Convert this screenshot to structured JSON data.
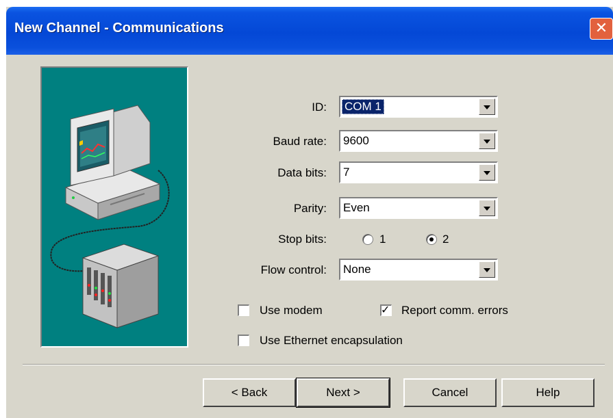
{
  "window": {
    "title": "New Channel - Communications",
    "close_glyph": "✕"
  },
  "form": {
    "id": {
      "label": "ID:",
      "value": "COM 1"
    },
    "baud_rate": {
      "label": "Baud rate:",
      "value": "9600"
    },
    "data_bits": {
      "label": "Data bits:",
      "value": "7"
    },
    "parity": {
      "label": "Parity:",
      "value": "Even"
    },
    "stop_bits": {
      "label": "Stop bits:",
      "options": [
        "1",
        "2"
      ],
      "selected": "2"
    },
    "flow_control": {
      "label": "Flow control:",
      "value": "None"
    }
  },
  "options": {
    "use_modem": {
      "label": "Use modem",
      "checked": false
    },
    "report_errors": {
      "label": "Report comm. errors",
      "checked": true
    },
    "ethernet": {
      "label": "Use Ethernet encapsulation",
      "checked": false
    }
  },
  "buttons": {
    "back": "< Back",
    "next": "Next >",
    "cancel": "Cancel",
    "help": "Help"
  },
  "colors": {
    "title_bar": "#0448d6",
    "dialog_bg": "#d8d6cb",
    "illustration_bg": "#008080",
    "selection": "#0a246a"
  },
  "icons": [
    "computer-illustration",
    "plc-rack-illustration",
    "close-icon",
    "dropdown-arrow-icon"
  ]
}
